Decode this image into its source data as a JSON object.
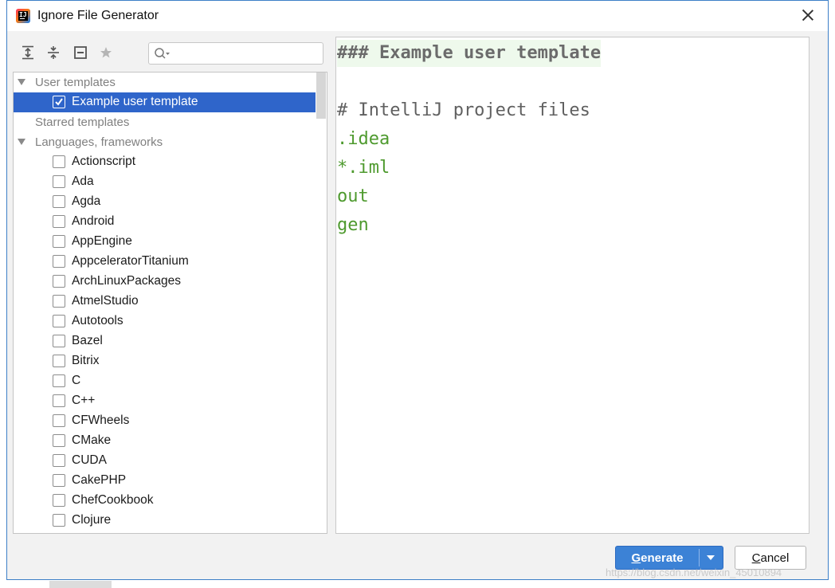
{
  "window": {
    "title": "Ignore File Generator",
    "app_icon": "intellij-idea-icon"
  },
  "toolbar": {
    "icons": [
      "expand-all-icon",
      "collapse-all-icon",
      "deselect-all-icon",
      "star-icon"
    ]
  },
  "search": {
    "value": "",
    "placeholder": ""
  },
  "tree": {
    "groups": [
      {
        "label": "User templates",
        "expanded": true
      },
      {
        "label": "Starred templates",
        "expanded": false
      },
      {
        "label": "Languages, frameworks",
        "expanded": true
      }
    ],
    "user_templates": [
      {
        "label": "Example user template",
        "checked": true,
        "selected": true
      }
    ],
    "languages": [
      {
        "label": "Actionscript",
        "checked": false
      },
      {
        "label": "Ada",
        "checked": false
      },
      {
        "label": "Agda",
        "checked": false
      },
      {
        "label": "Android",
        "checked": false
      },
      {
        "label": "AppEngine",
        "checked": false
      },
      {
        "label": "AppceleratorTitanium",
        "checked": false
      },
      {
        "label": "ArchLinuxPackages",
        "checked": false
      },
      {
        "label": "AtmelStudio",
        "checked": false
      },
      {
        "label": "Autotools",
        "checked": false
      },
      {
        "label": "Bazel",
        "checked": false
      },
      {
        "label": "Bitrix",
        "checked": false
      },
      {
        "label": "C",
        "checked": false
      },
      {
        "label": "C++",
        "checked": false
      },
      {
        "label": "CFWheels",
        "checked": false
      },
      {
        "label": "CMake",
        "checked": false
      },
      {
        "label": "CUDA",
        "checked": false
      },
      {
        "label": "CakePHP",
        "checked": false
      },
      {
        "label": "ChefCookbook",
        "checked": false
      },
      {
        "label": "Clojure",
        "checked": false
      }
    ]
  },
  "editor": {
    "lines": [
      {
        "text": "### Example user template",
        "kind": "header"
      },
      {
        "text": "",
        "kind": "blank"
      },
      {
        "text": "# IntelliJ project files",
        "kind": "comment"
      },
      {
        "text": ".idea",
        "kind": "entry"
      },
      {
        "text": "*.iml",
        "kind": "entry"
      },
      {
        "text": "out",
        "kind": "entry"
      },
      {
        "text": "gen",
        "kind": "entry"
      }
    ]
  },
  "buttons": {
    "generate_label": "Generate",
    "generate_mnemonic": "G",
    "cancel_label": "Cancel",
    "cancel_mnemonic": "C"
  },
  "watermark": "https://blog.csdn.net/weixin_45010894",
  "colors": {
    "selection": "#2f65ca",
    "primary_button": "#3c82d6",
    "entry_green": "#4e9a2e",
    "header_bg": "#eef9ec"
  }
}
